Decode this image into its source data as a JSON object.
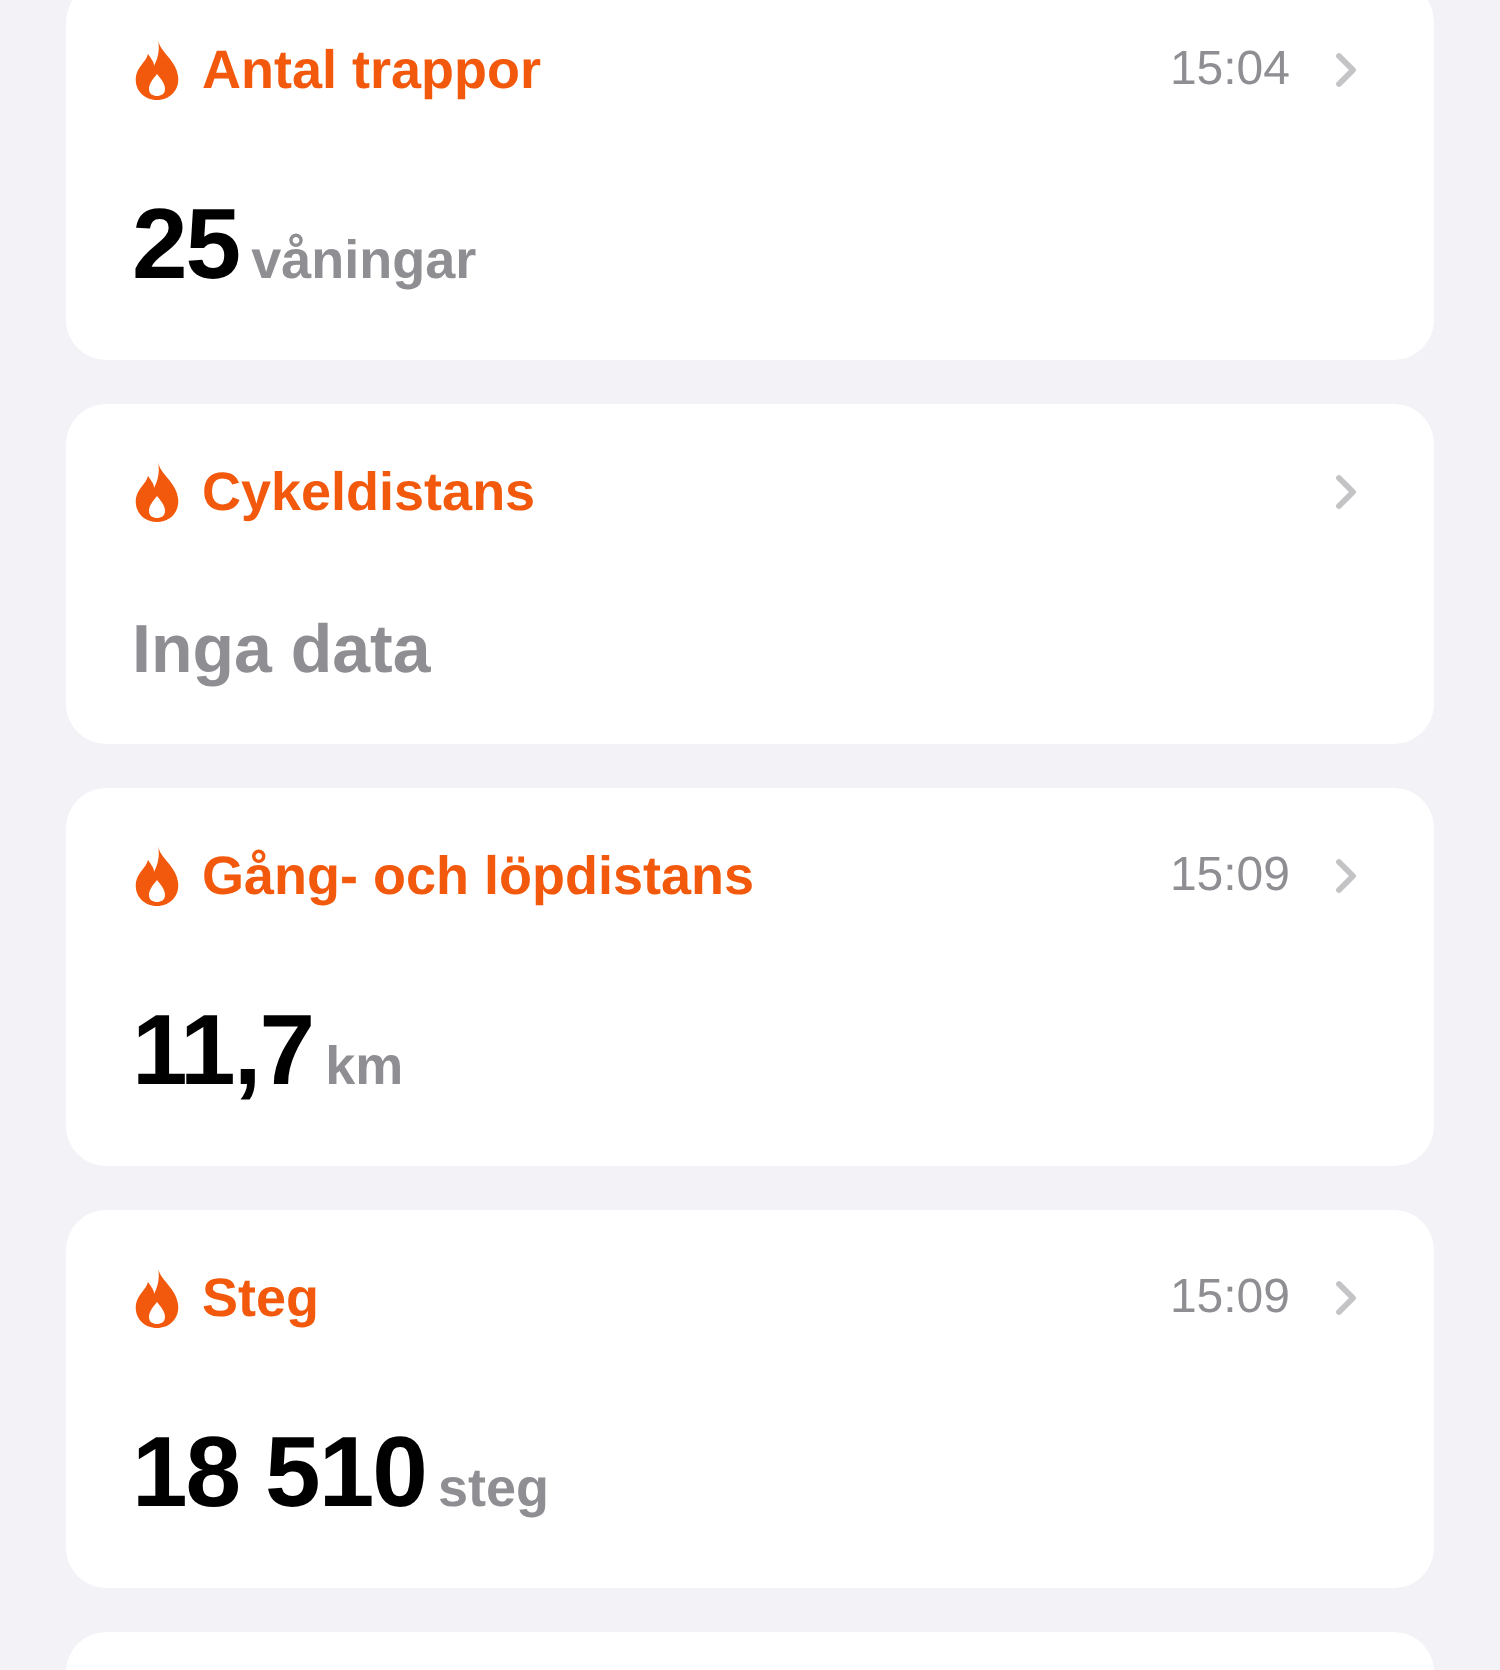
{
  "cards": [
    {
      "kind": "value",
      "title": "Antal trappor",
      "time": "15:04",
      "value": "25",
      "unit": "våningar"
    },
    {
      "kind": "empty",
      "title": "Cykeldistans",
      "value": "Inga data"
    },
    {
      "kind": "value",
      "title": "Gång- och löpdistans",
      "time": "15:09",
      "value": "11,7",
      "unit": "km"
    },
    {
      "kind": "value",
      "title": "Steg",
      "time": "15:09",
      "value": "18 510",
      "unit": "steg"
    },
    {
      "kind": "cut"
    }
  ]
}
